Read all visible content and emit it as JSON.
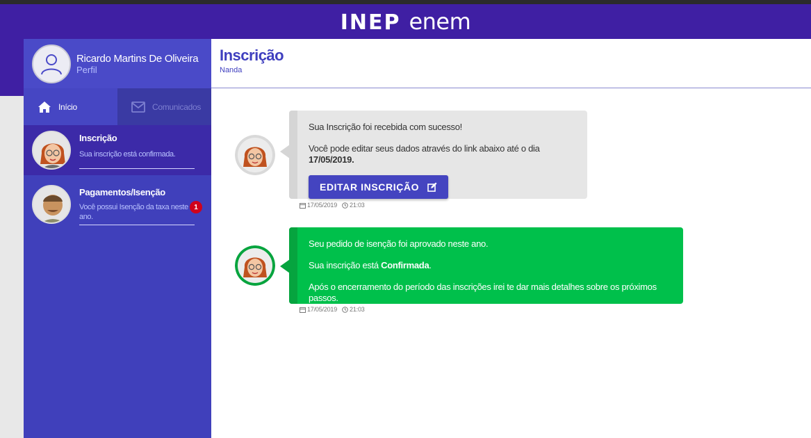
{
  "header": {
    "logo_left": "INEP",
    "logo_right": "enem"
  },
  "sidebar": {
    "profile": {
      "name": "Ricardo Martins De Oliveira",
      "subtitle": "Perfil"
    },
    "tabs": [
      {
        "label": "Início",
        "icon": "home-icon"
      },
      {
        "label": "Comunicados",
        "icon": "envelope-icon"
      }
    ],
    "conversations": [
      {
        "title": "Inscrição",
        "subtitle": "Sua inscrição está confirmada."
      },
      {
        "title": "Pagamentos/Isenção",
        "subtitle": "Você possui Isenção da taxa neste ano.",
        "badge": "1"
      }
    ]
  },
  "main": {
    "title": "Inscrição",
    "subtitle": "Nanda",
    "messages": [
      {
        "line1": "Sua Inscrição foi recebida com sucesso!",
        "line2_prefix": "Você pode editar seus dados através do link abaixo até o dia ",
        "line2_bold": "17/05/2019.",
        "button_label": "EDITAR INSCRIÇÃO",
        "date": "17/05/2019",
        "time": "21:03"
      },
      {
        "line1": "Seu pedido de isenção foi aprovado neste ano.",
        "line2_prefix": "Sua inscrição está ",
        "line2_bold": "Confirmada",
        "line2_suffix": ".",
        "line3": "Após o encerramento do período das inscrições irei te dar mais detalhes sobre os próximos passos.",
        "date": "17/05/2019",
        "time": "21:03"
      }
    ]
  },
  "colors": {
    "brand": "#3f1fa3",
    "sidebar": "#4040bb",
    "accent": "#4444c0",
    "success": "#00c04b",
    "badge": "#d0021b"
  }
}
